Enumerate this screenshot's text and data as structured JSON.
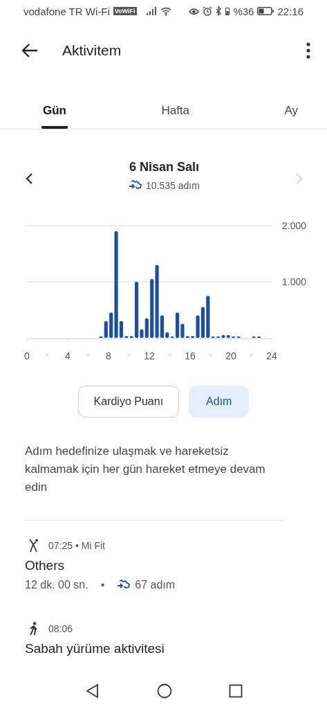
{
  "status_bar": {
    "carrier": "vodafone TR Wi-Fi",
    "vowifi": "VoWiFi",
    "battery_percent": "%36",
    "time": "22:16"
  },
  "app_bar": {
    "title": "Aktivitem"
  },
  "tabs": [
    {
      "label": "Gün",
      "selected": true
    },
    {
      "label": "Hafta",
      "selected": false
    },
    {
      "label": "Ay",
      "selected": false
    }
  ],
  "date_nav": {
    "title": "6 Nisan Salı",
    "steps": "10.535 adım",
    "prev_disabled": false,
    "next_disabled": true
  },
  "chart_data": {
    "type": "bar",
    "x": [
      7.25,
      7.75,
      8.25,
      8.75,
      9.25,
      9.75,
      10.25,
      10.75,
      11.25,
      11.75,
      12.25,
      12.75,
      13.25,
      13.75,
      14.25,
      14.75,
      15.25,
      15.75,
      16.25,
      16.75,
      17.25,
      17.75,
      18.25,
      18.75,
      19.25,
      19.75,
      20.25,
      20.75,
      22.25,
      22.75
    ],
    "series": [
      {
        "color": "#1b4fa3",
        "values": [
          20,
          300,
          450,
          1900,
          300,
          30,
          30,
          1000,
          150,
          350,
          1050,
          1300,
          400,
          100,
          10,
          450,
          250,
          30,
          30,
          400,
          550,
          750,
          10,
          10,
          50,
          50,
          10,
          10,
          10,
          10
        ]
      }
    ],
    "xlim": [
      0,
      24
    ],
    "ylim": [
      0,
      2000
    ],
    "xticks": [
      0,
      4,
      8,
      12,
      16,
      20,
      24
    ],
    "yticks": [
      {
        "value": 1000,
        "label": "1.000"
      },
      {
        "value": 2000,
        "label": "2.000"
      }
    ]
  },
  "metric_buttons": [
    {
      "label": "Kardiyo Puanı",
      "selected": false
    },
    {
      "label": "Adım",
      "selected": true
    }
  ],
  "description": "Adım hedefinize ulaşmak ve hareketsiz kalmamak için her gün hareket etmeye devam edin",
  "activities": [
    {
      "kind": "other",
      "time": "07:25 • Mi Fit",
      "title": "Others",
      "duration": "12 dk. 00 sn.",
      "separator": "•",
      "steps": "67 adım"
    },
    {
      "kind": "walk",
      "time": "08:06",
      "title": "Sabah yürüme aktivitesi"
    }
  ]
}
